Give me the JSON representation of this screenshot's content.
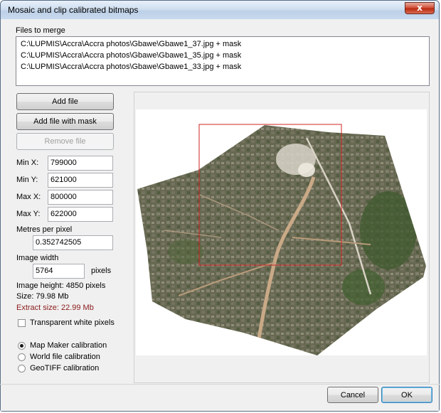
{
  "window": {
    "title": "Mosaic and clip calibrated bitmaps",
    "close_glyph": "x"
  },
  "files": {
    "label": "Files to merge",
    "items": [
      "C:\\LUPMIS\\Accra\\Accra photos\\Gbawe\\Gbawe1_37.jpg + mask",
      "C:\\LUPMIS\\Accra\\Accra photos\\Gbawe\\Gbawe1_35.jpg + mask",
      "C:\\LUPMIS\\Accra\\Accra photos\\Gbawe\\Gbawe1_33.jpg + mask"
    ]
  },
  "buttons": {
    "add_file": "Add file",
    "add_file_mask": "Add file with mask",
    "remove_file": "Remove file",
    "cancel": "Cancel",
    "ok": "OK"
  },
  "extent": {
    "min_x_label": "Min X:",
    "min_x": "799000",
    "min_y_label": "Min Y:",
    "min_y": "621000",
    "max_x_label": "Max X:",
    "max_x": "800000",
    "max_y_label": "Max Y:",
    "max_y": "622000"
  },
  "resolution": {
    "mpp_label": "Metres per pixel",
    "mpp": "0.352742505",
    "width_label": "Image width",
    "width": "5764",
    "width_unit": "pixels",
    "height_text": "Image height: 4850 pixels",
    "size_text": "Size: 79.98 Mb",
    "extract_text": "Extract size: 22.99 Mb"
  },
  "options": {
    "transparent_label": "Transparent white pixels",
    "transparent_checked": false,
    "calibration": [
      {
        "label": "Map Maker calibration",
        "checked": true
      },
      {
        "label": "World file calibration",
        "checked": false
      },
      {
        "label": "GeoTIFF calibration",
        "checked": false
      }
    ]
  },
  "colors": {
    "clip_rect": "#d02020",
    "extract_text": "#8b1a1a"
  }
}
